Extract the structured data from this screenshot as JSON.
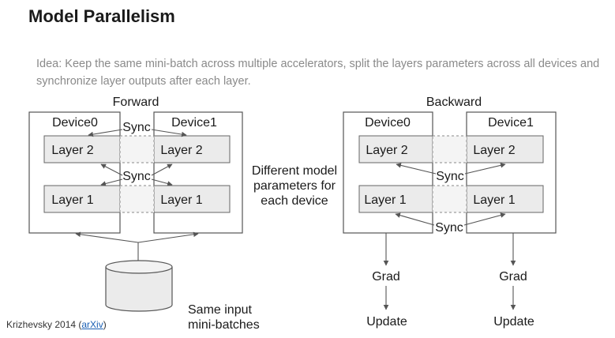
{
  "title": "Model Parallelism",
  "idea": "Idea: Keep the same mini-batch across multiple accelerators, split the layers parameters across all devices and synchronize layer outputs after each layer.",
  "forward": {
    "heading": "Forward",
    "device0": "Device0",
    "device1": "Device1",
    "layer2": "Layer 2",
    "layer1": "Layer 1",
    "sync_top": "Sync",
    "sync_mid": "Sync"
  },
  "backward": {
    "heading": "Backward",
    "device0": "Device0",
    "device1": "Device1",
    "layer2": "Layer 2",
    "layer1": "Layer 1",
    "sync_mid": "Sync",
    "sync_bottom": "Sync",
    "grad": "Grad",
    "update": "Update"
  },
  "middle_note": [
    "Different model",
    "parameters for",
    "each device"
  ],
  "input_note": [
    "Same input",
    "mini-batches"
  ],
  "footer": {
    "citation": "Krizhevsky 2014 (",
    "link": "arXiv",
    "close": ")"
  }
}
